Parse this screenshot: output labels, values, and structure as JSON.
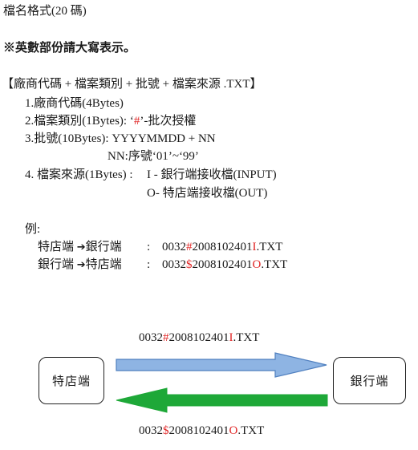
{
  "title": "檔名格式(20 碼)",
  "note": "※英數部份請大寫表示。",
  "format_line": "【廠商代碼 + 檔案類別 + 批號 + 檔案來源 .TXT】",
  "items": {
    "item1": "1.廠商代碼(4Bytes)",
    "item2_prefix": "2.檔案類別(1Bytes): ‘",
    "item2_hash": "#",
    "item2_suffix": "’-批次授權",
    "item3": "3.批號(10Bytes): YYYYMMDD + NN",
    "item3_nn": "NN:序號‘01’~‘99’",
    "item4_label": "4.  檔案來源(1Bytes) :",
    "item4_i": "I -  銀行端接收檔(INPUT)",
    "item4_o": "O-  特店端接收檔(OUT)"
  },
  "example": {
    "label": "例:",
    "row1": {
      "from": "特店端",
      "arrow": "➔",
      "to": "銀行端",
      "colon": ":",
      "code_prefix": "0032",
      "code_mark": "#",
      "code_mid": "2008102401",
      "code_src": "I",
      "code_ext": ".TXT"
    },
    "row2": {
      "from": "銀行端",
      "arrow": "➔",
      "to": "特店端",
      "colon": ":",
      "code_prefix": "0032",
      "code_mark": "$",
      "code_mid": "2008102401",
      "code_src": "O",
      "code_ext": ".TXT"
    }
  },
  "diagram": {
    "left_box": "特店端",
    "right_box": "銀行端",
    "top_file": {
      "prefix": "0032",
      "mark": "#",
      "mid": "2008102401",
      "src": "I",
      "ext": ".TXT"
    },
    "bottom_file": {
      "prefix": "0032",
      "mark": "$",
      "mid": "2008102401",
      "src": "O",
      "ext": ".TXT"
    },
    "colors": {
      "top_arrow_fill": "#8eb4e3",
      "top_arrow_stroke": "#4f7fbf",
      "bottom_arrow_fill": "#1ea838",
      "highlight": "#e02424"
    }
  }
}
